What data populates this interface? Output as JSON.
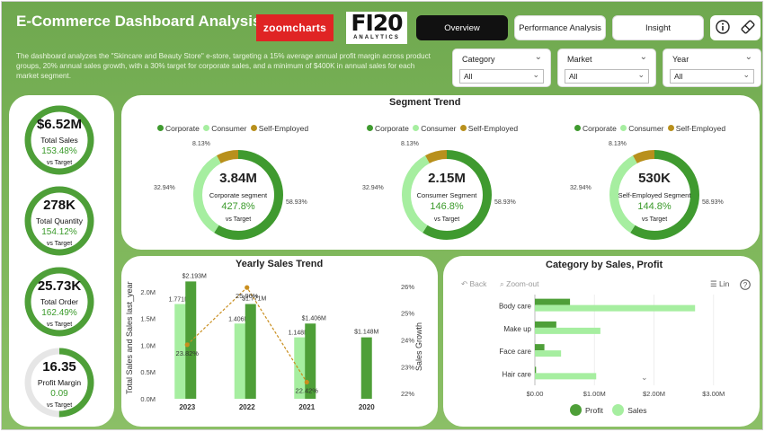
{
  "header": {
    "title": "E-Commerce Dashboard Analysis",
    "description": "The dashboard analyzes the \"Skincare and Beauty Store\" e-store, targeting a 15% average annual profit margin across product groups, 20% annual sales growth, with a 30% target for corporate sales, and a minimum of $400K in annual sales for each market segment.",
    "logo_zoom": "zoomcharts",
    "logo_fi_big": "FI20",
    "logo_fi_small": "ANALYTICS",
    "tabs": [
      "Overview",
      "Performance Analysis",
      "Insight"
    ],
    "info_icon": "info-icon",
    "eraser_icon": "eraser-icon"
  },
  "filters": [
    {
      "label": "Category",
      "value": "All"
    },
    {
      "label": "Market",
      "value": "All"
    },
    {
      "label": "Year",
      "value": "All"
    }
  ],
  "kpis": [
    {
      "value": "$6.52M",
      "label": "Total Sales",
      "pct": "153.48%",
      "target": "vs Target",
      "fill": 1.0
    },
    {
      "value": "278K",
      "label": "Total Quantity",
      "pct": "154.12%",
      "target": "vs Target",
      "fill": 1.0
    },
    {
      "value": "25.73K",
      "label": "Total Order",
      "pct": "162.49%",
      "target": "vs Target",
      "fill": 1.0
    },
    {
      "value": "16.35",
      "label": "Profit Margin",
      "pct": "0.09",
      "target": "vs Target",
      "fill": 0.5
    }
  ],
  "segment": {
    "title": "Segment Trend",
    "legend": [
      "Corporate",
      "Consumer",
      "Self-Employed"
    ],
    "colors": {
      "corporate": "#3f9a2f",
      "consumer": "#a6eea0",
      "self": "#b8901c"
    },
    "donuts": [
      {
        "value": "3.84M",
        "label": "Corporate segment",
        "pct": "427.8%",
        "target": "vs Target",
        "shares": [
          58.93,
          32.94,
          8.13
        ],
        "labels": [
          "8.13%",
          "32.94%",
          "58.93%"
        ]
      },
      {
        "value": "2.15M",
        "label": "Consumer Segment",
        "pct": "146.8%",
        "target": "vs Target",
        "shares": [
          58.93,
          32.94,
          8.13
        ],
        "labels": [
          "8.13%",
          "32.94%",
          "58.93%"
        ]
      },
      {
        "value": "530K",
        "label": "Self-Employed Segment",
        "pct": "144.8%",
        "target": "vs Target",
        "shares": [
          58.93,
          32.94,
          8.13
        ],
        "labels": [
          "8.13%",
          "32.94%",
          "58.93%"
        ]
      }
    ]
  },
  "yearly": {
    "title": "Yearly Sales Trend",
    "ylabel": "Total Sales and Sales last_year",
    "y2label": "Sales Growth",
    "yticks": [
      "2.0M",
      "1.5M",
      "1.0M",
      "0.5M",
      "0.0M"
    ],
    "y2ticks": [
      "26%",
      "25%",
      "24%",
      "23%",
      "22%"
    ]
  },
  "category": {
    "title": "Category by Sales, Profit",
    "back": "Back",
    "zoom_out": "Zoom-out",
    "lin": "Lin",
    "xticks": [
      "$0.00",
      "$1.00M",
      "$2.00M",
      "$3.00M"
    ],
    "legend": [
      "Profit",
      "Sales"
    ]
  },
  "chart_data": [
    {
      "type": "bar",
      "title": "Yearly Sales Trend",
      "categories": [
        "2023",
        "2022",
        "2021",
        "2020"
      ],
      "series": [
        {
          "name": "Sales last_year",
          "values": [
            1.771,
            1.406,
            1.148,
            null
          ]
        },
        {
          "name": "Total Sales",
          "values": [
            2.193,
            1.771,
            1.406,
            1.148
          ]
        },
        {
          "name": "Sales Growth",
          "values": [
            23.82,
            25.96,
            22.42,
            null
          ]
        }
      ],
      "labels": {
        "last_year": [
          "1.771M",
          "1.406M",
          "1.148M",
          ""
        ],
        "total": [
          "$2.193M",
          "$1.771M",
          "$1.406M",
          "$1.148M"
        ],
        "growth": [
          "23.82%",
          "25.96%",
          "22.42%",
          ""
        ]
      },
      "xlabel": "",
      "ylabel": "Total Sales and Sales last_year",
      "ylim": [
        0,
        2.3
      ],
      "y2label": "Sales Growth",
      "y2lim": [
        21.8,
        26.4
      ],
      "colors": {
        "last_year": "#a6eea0",
        "total": "#4e9f38",
        "growth": "#c98e1e"
      }
    },
    {
      "type": "bar",
      "title": "Category by Sales, Profit",
      "categories": [
        "Body care",
        "Make up",
        "Face care",
        "Hair care"
      ],
      "series": [
        {
          "name": "Profit",
          "values": [
            0.59,
            0.36,
            0.16,
            0.02
          ]
        },
        {
          "name": "Sales",
          "values": [
            2.69,
            1.1,
            0.44,
            1.03
          ]
        }
      ],
      "xlim": [
        0,
        3.2
      ],
      "colors": {
        "profit": "#4e9f38",
        "sales": "#a6eea0"
      }
    }
  ]
}
